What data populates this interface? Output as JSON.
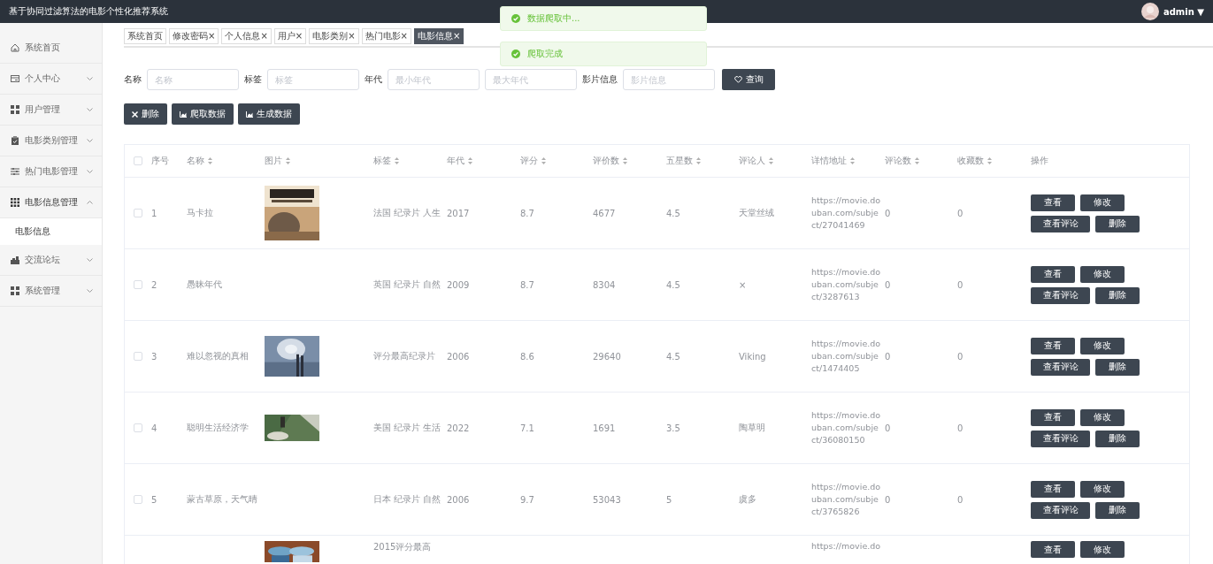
{
  "header": {
    "title": "基于协同过滤算法的电影个性化推荐系统",
    "user": "admin",
    "menu_caret": "▼"
  },
  "toasts": [
    {
      "text": "数据爬取中..."
    },
    {
      "text": "爬取完成"
    }
  ],
  "sidebar": {
    "items": [
      {
        "label": "系统首页",
        "kind": "home"
      },
      {
        "label": "个人中心",
        "kind": "card",
        "expanded": false
      },
      {
        "label": "用户管理",
        "kind": "grid",
        "expanded": false
      },
      {
        "label": "电影类别管理",
        "kind": "clipboard",
        "expanded": false
      },
      {
        "label": "热门电影管理",
        "kind": "sliders",
        "expanded": false
      },
      {
        "label": "电影信息管理",
        "kind": "dots",
        "expanded": true,
        "children": [
          {
            "label": "电影信息",
            "selected": true
          }
        ]
      },
      {
        "label": "交流论坛",
        "kind": "forum",
        "expanded": false
      },
      {
        "label": "系统管理",
        "kind": "grid",
        "expanded": false
      }
    ]
  },
  "tabs": [
    {
      "label": "系统首页",
      "selected": false
    },
    {
      "label": "修改密码",
      "close": "×",
      "selected": false
    },
    {
      "label": "个人信息",
      "close": "×",
      "selected": false
    },
    {
      "label": "用户",
      "close": "×",
      "selected": false
    },
    {
      "label": "电影类别",
      "close": "×",
      "selected": false
    },
    {
      "label": "热门电影",
      "close": "×",
      "selected": false
    },
    {
      "label": "电影信息",
      "close": "×",
      "selected": true
    }
  ],
  "search": {
    "fields": [
      {
        "label": "名称",
        "placeholder": "名称"
      },
      {
        "label": "标签",
        "placeholder": "标签"
      },
      {
        "label": "年代",
        "placeholder": "最小年代"
      },
      {
        "placeholder": "最大年代"
      },
      {
        "label": "影片信息",
        "placeholder": "影片信息"
      }
    ],
    "button": "查询"
  },
  "actions": [
    {
      "label": "删除",
      "kind": "close"
    },
    {
      "label": "爬取数据",
      "kind": "chart"
    },
    {
      "label": "生成数据",
      "kind": "chart"
    }
  ],
  "table": {
    "all_checked": false,
    "columns": [
      {
        "label": "序号",
        "sortable": false
      },
      {
        "label": "名称",
        "sortable": true
      },
      {
        "label": "图片",
        "sortable": true
      },
      {
        "label": "标签",
        "sortable": true
      },
      {
        "label": "年代",
        "sortable": true
      },
      {
        "label": "评分",
        "sortable": true
      },
      {
        "label": "评价数",
        "sortable": true
      },
      {
        "label": "五星数",
        "sortable": true
      },
      {
        "label": "评论人",
        "sortable": true
      },
      {
        "label": "详情地址",
        "sortable": true
      },
      {
        "label": "评论数",
        "sortable": true
      },
      {
        "label": "收藏数",
        "sortable": true
      },
      {
        "label": "操作",
        "sortable": false
      }
    ],
    "rows": [
      {
        "checked": false,
        "no": "1",
        "name": "马卡拉",
        "picture": {
          "kind": "picture"
        },
        "tags": "法国 纪录片 人生",
        "year": "2017",
        "score": "8.7",
        "votes": "4677",
        "five_star": "4.5",
        "reviewer": "天堂丝绒",
        "url": "https://movie.douban.com/subject/27041469",
        "comments": "0",
        "favorites": "0",
        "buttons": [
          "查看",
          "修改",
          "查看评论",
          "删除"
        ]
      },
      {
        "checked": false,
        "no": "2",
        "name": "愚昧年代",
        "tags": "英国 纪录片 自然",
        "year": "2009",
        "score": "8.7",
        "votes": "8304",
        "five_star": "4.5",
        "reviewer": "×",
        "url": "https://movie.douban.com/subject/3287613",
        "comments": "0",
        "favorites": "0",
        "buttons": [
          "查看",
          "修改",
          "查看评论",
          "删除"
        ]
      },
      {
        "checked": false,
        "no": "3",
        "name": "难以忽视的真相",
        "picture": {
          "kind": "picture"
        },
        "tags": "评分最高纪录片",
        "year": "2006",
        "score": "8.6",
        "votes": "29640",
        "five_star": "4.5",
        "reviewer": "Viking",
        "url": "https://movie.douban.com/subject/1474405",
        "comments": "0",
        "favorites": "0",
        "buttons": [
          "查看",
          "修改",
          "查看评论",
          "删除"
        ]
      },
      {
        "checked": false,
        "no": "4",
        "name": "聪明生活经济学",
        "picture": {
          "kind": "picture"
        },
        "tags": "美国 纪录片 生活",
        "year": "2022",
        "score": "7.1",
        "votes": "1691",
        "five_star": "3.5",
        "reviewer": "陶草明",
        "url": "https://movie.douban.com/subject/36080150",
        "comments": "0",
        "favorites": "0",
        "buttons": [
          "查看",
          "修改",
          "查看评论",
          "删除"
        ]
      },
      {
        "checked": false,
        "no": "5",
        "name": "蒙古草原，天气晴",
        "tags": "日本 纪录片 自然",
        "year": "2006",
        "score": "9.7",
        "votes": "53043",
        "five_star": "5",
        "reviewer": "虞多",
        "url": "https://movie.douban.com/subject/3765826",
        "comments": "0",
        "favorites": "0",
        "buttons": [
          "查看",
          "修改",
          "查看评论",
          "删除"
        ]
      },
      {
        "picture": {
          "kind": "picture"
        },
        "tags": "2015评分最高",
        "url": "https://movie.do",
        "buttons": [
          "查看",
          "修改"
        ]
      }
    ]
  }
}
